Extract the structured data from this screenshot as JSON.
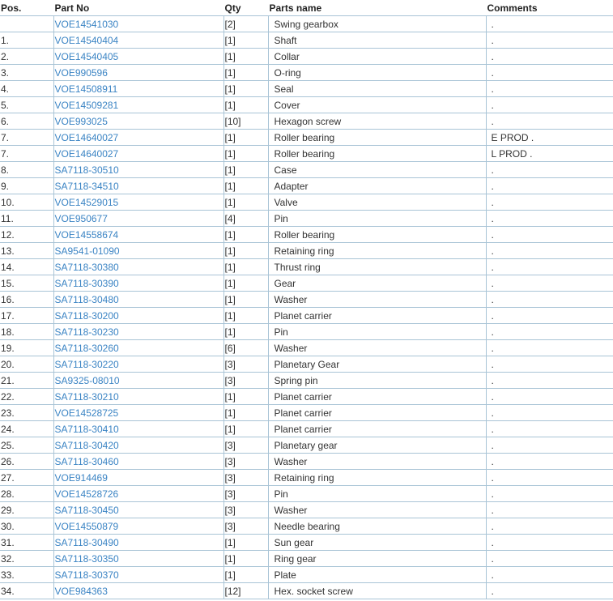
{
  "headers": {
    "pos": "Pos.",
    "part_no": "Part No",
    "qty": "Qty",
    "name": "Parts name",
    "comments": "Comments"
  },
  "rows": [
    {
      "pos": "",
      "part_no": "VOE14541030",
      "qty": "[2]",
      "name": "Swing gearbox",
      "comment": "."
    },
    {
      "pos": "1.",
      "part_no": "VOE14540404",
      "qty": "[1]",
      "name": "Shaft",
      "comment": "."
    },
    {
      "pos": "2.",
      "part_no": "VOE14540405",
      "qty": "[1]",
      "name": "Collar",
      "comment": "."
    },
    {
      "pos": "3.",
      "part_no": "VOE990596",
      "qty": "[1]",
      "name": "O-ring",
      "comment": "."
    },
    {
      "pos": "4.",
      "part_no": "VOE14508911",
      "qty": "[1]",
      "name": "Seal",
      "comment": "."
    },
    {
      "pos": "5.",
      "part_no": "VOE14509281",
      "qty": "[1]",
      "name": "Cover",
      "comment": "."
    },
    {
      "pos": "6.",
      "part_no": "VOE993025",
      "qty": "[10]",
      "name": "Hexagon screw",
      "comment": "."
    },
    {
      "pos": "7.",
      "part_no": "VOE14640027",
      "qty": "[1]",
      "name": "Roller bearing",
      "comment": "E PROD ."
    },
    {
      "pos": "7.",
      "part_no": "VOE14640027",
      "qty": "[1]",
      "name": "Roller bearing",
      "comment": "L PROD ."
    },
    {
      "pos": "8.",
      "part_no": "SA7118-30510",
      "qty": "[1]",
      "name": "Case",
      "comment": "."
    },
    {
      "pos": "9.",
      "part_no": "SA7118-34510",
      "qty": "[1]",
      "name": "Adapter",
      "comment": "."
    },
    {
      "pos": "10.",
      "part_no": "VOE14529015",
      "qty": "[1]",
      "name": "Valve",
      "comment": "."
    },
    {
      "pos": "11.",
      "part_no": "VOE950677",
      "qty": "[4]",
      "name": "Pin",
      "comment": "."
    },
    {
      "pos": "12.",
      "part_no": "VOE14558674",
      "qty": "[1]",
      "name": "Roller bearing",
      "comment": "."
    },
    {
      "pos": "13.",
      "part_no": "SA9541-01090",
      "qty": "[1]",
      "name": "Retaining ring",
      "comment": "."
    },
    {
      "pos": "14.",
      "part_no": "SA7118-30380",
      "qty": "[1]",
      "name": "Thrust ring",
      "comment": "."
    },
    {
      "pos": "15.",
      "part_no": "SA7118-30390",
      "qty": "[1]",
      "name": "Gear",
      "comment": "."
    },
    {
      "pos": "16.",
      "part_no": "SA7118-30480",
      "qty": "[1]",
      "name": "Washer",
      "comment": "."
    },
    {
      "pos": "17.",
      "part_no": "SA7118-30200",
      "qty": "[1]",
      "name": "Planet carrier",
      "comment": "."
    },
    {
      "pos": "18.",
      "part_no": "SA7118-30230",
      "qty": "[1]",
      "name": "Pin",
      "comment": "."
    },
    {
      "pos": "19.",
      "part_no": "SA7118-30260",
      "qty": "[6]",
      "name": "Washer",
      "comment": "."
    },
    {
      "pos": "20.",
      "part_no": "SA7118-30220",
      "qty": "[3]",
      "name": "Planetary Gear",
      "comment": "."
    },
    {
      "pos": "21.",
      "part_no": "SA9325-08010",
      "qty": "[3]",
      "name": "Spring pin",
      "comment": "."
    },
    {
      "pos": "22.",
      "part_no": "SA7118-30210",
      "qty": "[1]",
      "name": "Planet carrier",
      "comment": "."
    },
    {
      "pos": "23.",
      "part_no": "VOE14528725",
      "qty": "[1]",
      "name": "Planet carrier",
      "comment": "."
    },
    {
      "pos": "24.",
      "part_no": "SA7118-30410",
      "qty": "[1]",
      "name": "Planet carrier",
      "comment": "."
    },
    {
      "pos": "25.",
      "part_no": "SA7118-30420",
      "qty": "[3]",
      "name": "Planetary gear",
      "comment": "."
    },
    {
      "pos": "26.",
      "part_no": "SA7118-30460",
      "qty": "[3]",
      "name": "Washer",
      "comment": "."
    },
    {
      "pos": "27.",
      "part_no": "VOE914469",
      "qty": "[3]",
      "name": "Retaining ring",
      "comment": "."
    },
    {
      "pos": "28.",
      "part_no": "VOE14528726",
      "qty": "[3]",
      "name": "Pin",
      "comment": "."
    },
    {
      "pos": "29.",
      "part_no": "SA7118-30450",
      "qty": "[3]",
      "name": "Washer",
      "comment": "."
    },
    {
      "pos": "30.",
      "part_no": "VOE14550879",
      "qty": "[3]",
      "name": "Needle bearing",
      "comment": "."
    },
    {
      "pos": "31.",
      "part_no": "SA7118-30490",
      "qty": "[1]",
      "name": "Sun gear",
      "comment": "."
    },
    {
      "pos": "32.",
      "part_no": "SA7118-30350",
      "qty": "[1]",
      "name": "Ring gear",
      "comment": "."
    },
    {
      "pos": "33.",
      "part_no": "SA7118-30370",
      "qty": "[1]",
      "name": "Plate",
      "comment": "."
    },
    {
      "pos": "34.",
      "part_no": "VOE984363",
      "qty": "[12]",
      "name": "Hex. socket screw",
      "comment": "."
    }
  ]
}
